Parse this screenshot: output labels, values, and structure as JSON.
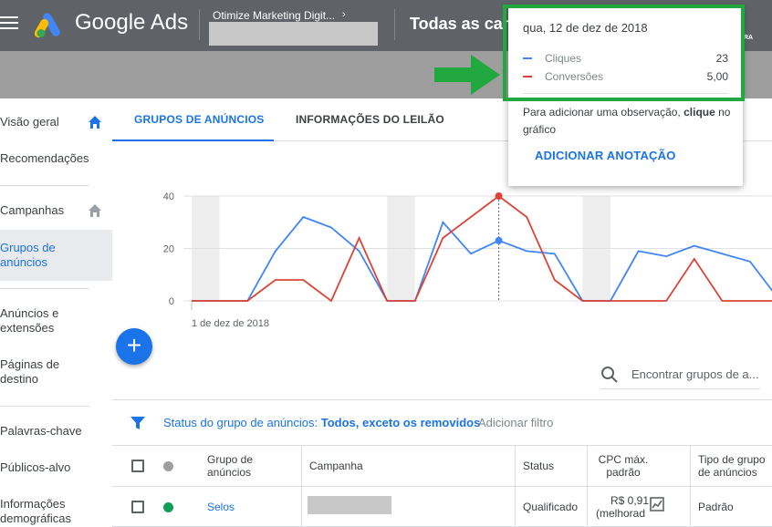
{
  "app": {
    "brand": "Google Ads",
    "account_name": "Otimize Marketing Digit...",
    "account_chevron": "›",
    "page_title": "Todas as cam",
    "topbar_right_label": "RA"
  },
  "sidebar": {
    "items": [
      {
        "label": "Visão geral",
        "home": true,
        "active": false
      },
      {
        "label": "Recomendações",
        "home": false,
        "active": false
      },
      {
        "label": "Campanhas",
        "home": true,
        "active": false
      },
      {
        "label": "Grupos de anúncios",
        "home": false,
        "active": true
      },
      {
        "label": "Anúncios e extensões",
        "home": false,
        "active": false
      },
      {
        "label": "Páginas de destino",
        "home": false,
        "active": false
      },
      {
        "label": "Palavras-chave",
        "home": false,
        "active": false
      },
      {
        "label": "Públicos-alvo",
        "home": false,
        "active": false
      },
      {
        "label": "Informações demográficas",
        "home": false,
        "active": false
      }
    ]
  },
  "tabs": [
    {
      "label": "GRUPOS DE ANÚNCIOS",
      "active": true
    },
    {
      "label": "INFORMAÇÕES DO LEILÃO",
      "active": false
    }
  ],
  "chart_data": {
    "type": "line",
    "x_start_label": "1 de dez de 2018",
    "y_ticks": [
      "40",
      "20",
      "0"
    ],
    "ylim": [
      0,
      40
    ],
    "series": [
      {
        "name": "Cliques",
        "color": "#4285f4",
        "values": [
          0,
          0,
          0,
          19,
          32,
          28,
          19,
          0,
          0,
          30,
          18,
          23,
          19,
          18,
          0,
          0,
          19,
          17,
          21,
          18,
          15,
          1
        ]
      },
      {
        "name": "Conversões",
        "color": "#db4437",
        "values": [
          0,
          0,
          0,
          8,
          8,
          0,
          24,
          0,
          0,
          24,
          32,
          40,
          32,
          8,
          0,
          0,
          0,
          0,
          16,
          0,
          0,
          0
        ]
      }
    ],
    "shaded_weekend_indices": [
      0,
      7,
      14
    ],
    "hover_index": 11
  },
  "tooltip": {
    "date": "qua, 12 de dez de 2018",
    "rows": [
      {
        "name": "Cliques",
        "value": "23",
        "color": "#4285f4"
      },
      {
        "name": "Conversões",
        "value": "5,00",
        "color": "#db4437"
      }
    ],
    "note_prefix": "Para adicionar uma observação, ",
    "note_bold": "clique",
    "note_suffix": " no gráfico",
    "action": "ADICIONAR ANOTAÇÃO"
  },
  "fab_label": "+",
  "search": {
    "placeholder": "Encontrar grupos de a..."
  },
  "filter": {
    "label": "Status do grupo de anúncios: ",
    "value": "Todos, exceto os removidos",
    "add": "Adicionar filtro"
  },
  "table": {
    "headers": {
      "ad_group": "Grupo de anúncios",
      "campaign": "Campanha",
      "status": "Status",
      "max_cpc": "CPC máx. padrão",
      "type": "Tipo de grupo de anúncios"
    },
    "rows": [
      {
        "ad_group": "Selos",
        "status": "Qualificado",
        "max_cpc": "R$ 0,91",
        "max_cpc_note": "(melhorad",
        "type": "Padrão",
        "dot_color": "#0f9d58"
      }
    ]
  },
  "colors": {
    "accent": "#1a73e8",
    "highlight": "#21a83e",
    "header_bg": "#5f6368"
  }
}
